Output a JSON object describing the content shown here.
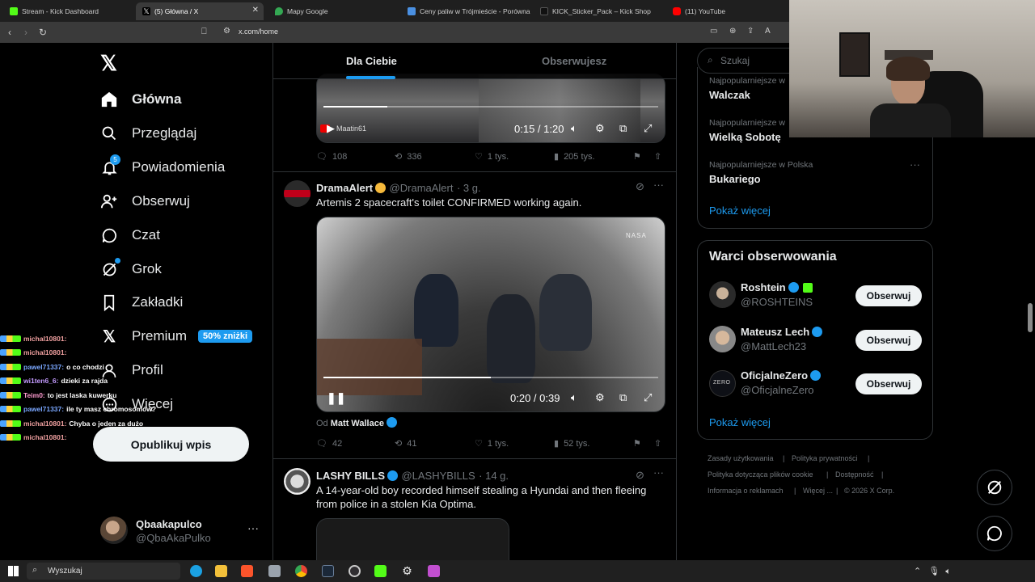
{
  "browser": {
    "tabs": [
      {
        "label": "Stream - Kick Dashboard",
        "color": "#53fc18"
      },
      {
        "label": "(5) Główna / X",
        "color": "#ffffff"
      },
      {
        "label": "Mapy Google",
        "color": "#34a853"
      },
      {
        "label": "Ceny paliw w Trójmieście - Porównan",
        "color": "#4a90e2"
      },
      {
        "label": "KICK_Sticker_Pack – Kick Shop",
        "color": "#111111"
      },
      {
        "label": "(11) YouTube",
        "color": "#ff0000"
      }
    ],
    "url": "x.com/home"
  },
  "nav": {
    "items": [
      {
        "label": "Główna",
        "icon": "home-icon"
      },
      {
        "label": "Przeglądaj",
        "icon": "search-icon"
      },
      {
        "label": "Powiadomienia",
        "icon": "bell-icon",
        "count": "5"
      },
      {
        "label": "Obserwuj",
        "icon": "follow-icon"
      },
      {
        "label": "Czat",
        "icon": "chat-icon"
      },
      {
        "label": "Grok",
        "icon": "grok-icon"
      },
      {
        "label": "Zakładki",
        "icon": "bookmark-icon"
      },
      {
        "label": "Premium",
        "icon": "x-premium-icon"
      },
      {
        "label": "Profil",
        "icon": "profile-icon"
      },
      {
        "label": "Więcej",
        "icon": "more-icon"
      }
    ],
    "premium_badge": "50% zniżki",
    "post_button": "Opublikuj wpis",
    "account": {
      "name": "Qbaakapulco",
      "handle": "@QbaAkaPulko"
    }
  },
  "feed": {
    "tabs": [
      "Dla Ciebie",
      "Obserwujesz"
    ],
    "post1": {
      "video_channel": "Maatin61",
      "time": "0:15 / 1:20",
      "progress": 0.19,
      "stats": {
        "replies": "108",
        "reposts": "336",
        "likes": "1 tys.",
        "views": "205 tys."
      }
    },
    "post2": {
      "name": "DramaAlert",
      "handle": "@DramaAlert",
      "time": "· 3 g.",
      "text": "Artemis 2 spacecraft's toilet CONFIRMED working again.",
      "video_watermark": "NASA",
      "video_time": "0:20 / 0:39",
      "progress": 0.5,
      "from_prefix": "Od",
      "from_name": "Matt Wallace",
      "stats": {
        "replies": "42",
        "reposts": "41",
        "likes": "1 tys.",
        "views": "52 tys."
      }
    },
    "post3": {
      "name": "LASHY BILLS",
      "handle": "@LASHYBILLS",
      "time": "· 14 g.",
      "text": "A 14-year-old boy recorded himself stealing a Hyundai and then fleeing from police in a stolen Kia Optima."
    }
  },
  "right": {
    "search_placeholder": "Szukaj",
    "trends": [
      {
        "sub": "Najpopularniejsze w",
        "name": "Walczak"
      },
      {
        "sub": "Najpopularniejsze w",
        "name": "Wielką Sobotę"
      },
      {
        "sub": "Najpopularniejsze w Polska",
        "name": "Bukariego"
      }
    ],
    "show_more": "Pokaż więcej",
    "who_to_follow_title": "Warci obserwowania",
    "follow_label": "Obserwuj",
    "suggestions": [
      {
        "name": "Roshtein",
        "handle": "@ROSHTEINS"
      },
      {
        "name": "Mateusz Lech",
        "handle": "@MattLech23"
      },
      {
        "name": "OficjalneZero",
        "handle": "@OficjalneZero"
      }
    ],
    "show_more_2": "Pokaż więcej",
    "footer": [
      "Zasady użytkowania",
      "Polityka prywatności",
      "Polityka dotycząca plików cookie",
      "Dostępność",
      "Informacja o reklamach",
      "Więcej ...",
      "© 2026 X Corp."
    ]
  },
  "chat": [
    {
      "user": "michal10801:",
      "msg": "",
      "color": "#f0a0a0"
    },
    {
      "user": "michal10801:",
      "msg": "",
      "color": "#f0a0a0"
    },
    {
      "user": "pawel71337:",
      "msg": "o co chodzi",
      "color": "#7aa7ff"
    },
    {
      "user": "wi1ten6_6:",
      "msg": "dzieki za rajda",
      "color": "#c49bff"
    },
    {
      "user": "Teim0:",
      "msg": "to jest laska kuwerku",
      "color": "#ff9bd0"
    },
    {
      "user": "pawel71337:",
      "msg": "ile ty masz chromosomów?",
      "color": "#7aa7ff"
    },
    {
      "user": "michal10801:",
      "msg": "Chyba o jeden za dużo",
      "color": "#f0a0a0"
    },
    {
      "user": "michal10801:",
      "msg": "",
      "color": "#f0a0a0"
    }
  ],
  "taskbar": {
    "search": "Wyszukaj"
  }
}
